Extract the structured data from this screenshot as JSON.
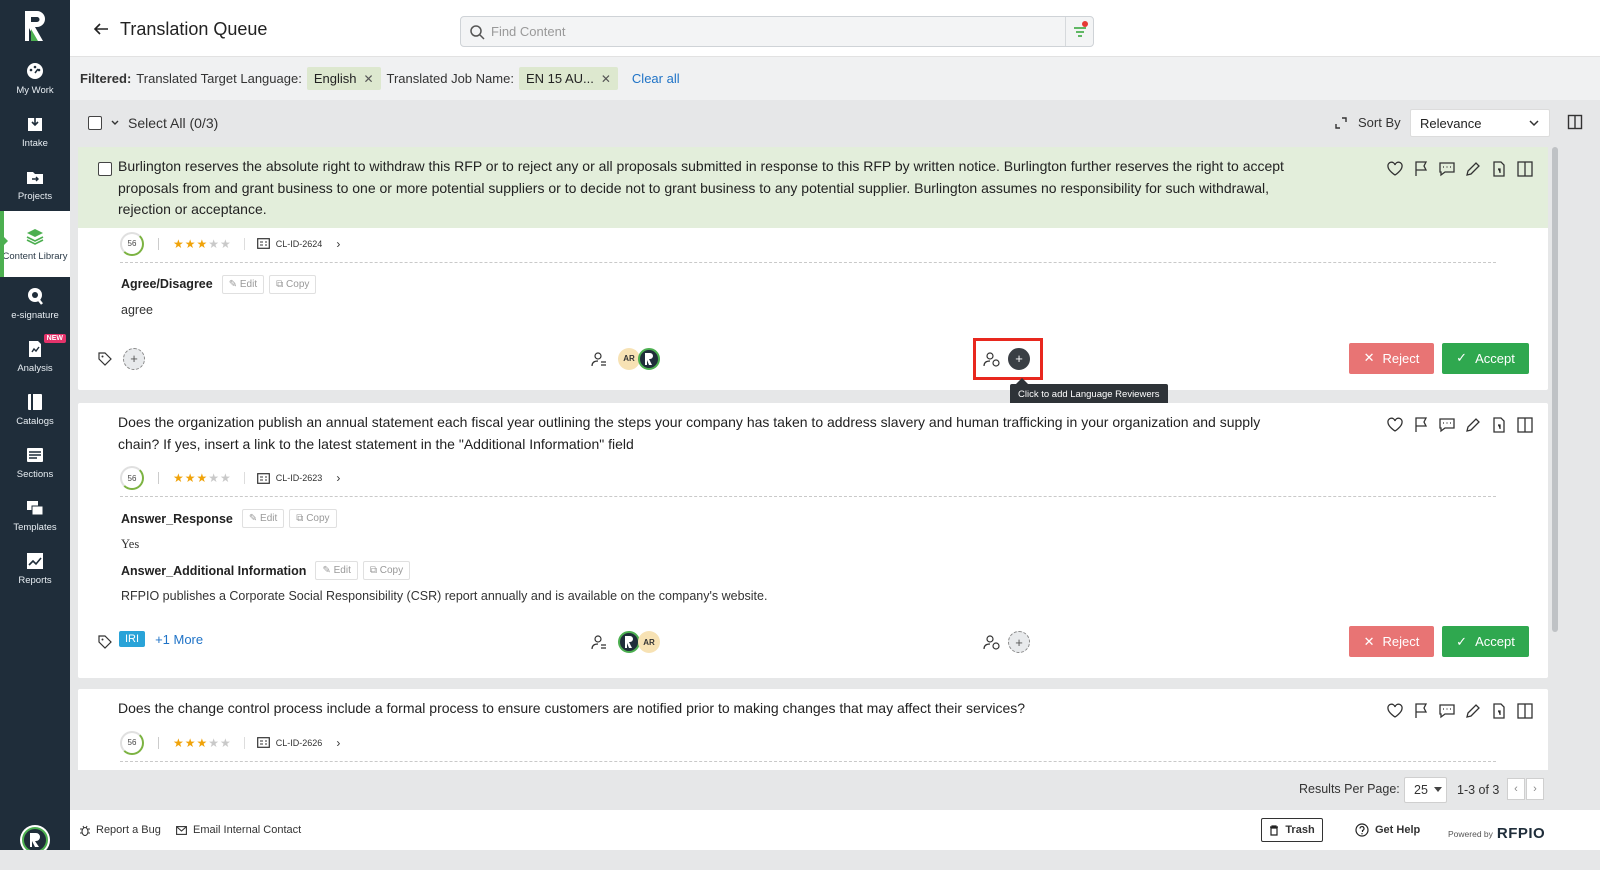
{
  "sidebar": {
    "items": [
      {
        "label": "My Work",
        "icon": "dashboard-icon"
      },
      {
        "label": "Intake",
        "icon": "intake-icon"
      },
      {
        "label": "Projects",
        "icon": "projects-icon"
      },
      {
        "label": "Content Library",
        "icon": "content-library-icon",
        "active": true
      },
      {
        "label": "e-signature",
        "icon": "esignature-icon"
      },
      {
        "label": "Analysis",
        "icon": "analysis-icon",
        "badge": "NEW"
      },
      {
        "label": "Catalogs",
        "icon": "catalogs-icon"
      },
      {
        "label": "Sections",
        "icon": "sections-icon"
      },
      {
        "label": "Templates",
        "icon": "templates-icon"
      },
      {
        "label": "Reports",
        "icon": "reports-icon"
      }
    ]
  },
  "header": {
    "title": "Translation Queue",
    "search_placeholder": "Find Content"
  },
  "filters": {
    "label": "Filtered:",
    "items": [
      {
        "name": "Translated Target Language:",
        "value": "English"
      },
      {
        "name": "Translated Job Name:",
        "value": "EN 15 AU..."
      }
    ],
    "clear": "Clear all"
  },
  "toolbar": {
    "select_all": "Select All (0/3)",
    "sort_label": "Sort By",
    "sort_value": "Relevance"
  },
  "cards": [
    {
      "question": "Burlington reserves the absolute right to withdraw this RFP or to reject any or all proposals submitted in response to this RFP by written notice. Burlington further reserves the right to accept proposals from and grant business to one or more potential suppliers or to decide not to grant business to any potential supplier. Burlington assumes no responsibility for such withdrawal, rejection or acceptance.",
      "score": "56",
      "rating": 3,
      "content_id": "CL-ID-2624",
      "fields": [
        {
          "name": "Agree/Disagree",
          "value": "agree"
        }
      ],
      "owner_avatar": "AR"
    },
    {
      "question": "Does the organization publish an annual statement each fiscal year outlining the steps your company has taken to address slavery and human trafficking in your organization and supply chain? If yes, insert a link to the latest statement in the \"Additional Information\" field",
      "score": "56",
      "rating": 3,
      "content_id": "CL-ID-2623",
      "fields": [
        {
          "name": "Answer_Response",
          "value": "Yes"
        },
        {
          "name": "Answer_Additional Information",
          "value": "RFPIO publishes a Corporate Social Responsibility (CSR) report annually and is available on the company's website."
        }
      ],
      "tag": "IRI",
      "more_tags": "+1 More",
      "owner_avatar": "AR"
    },
    {
      "question": "Does the change control process include a formal process to ensure customers are notified prior to making changes that may affect their services?",
      "score": "56",
      "rating": 3,
      "content_id": "CL-ID-2626"
    }
  ],
  "field_buttons": {
    "edit": "Edit",
    "copy": "Copy"
  },
  "buttons": {
    "reject": "Reject",
    "accept": "Accept"
  },
  "tooltip": "Click to add Language Reviewers",
  "pagination": {
    "label": "Results Per Page:",
    "per_page": "25",
    "range": "1-3 of 3"
  },
  "footer": {
    "report_bug": "Report a Bug",
    "email_contact": "Email Internal Contact",
    "trash": "Trash",
    "help": "Get Help",
    "powered_by": "Powered by",
    "brand": "RFPIO"
  },
  "colors": {
    "sidebar": "#1f2d3a",
    "accent": "#4caf50",
    "reject": "#e87474",
    "accept": "#2fa84f",
    "highlight": "#e3eedb"
  }
}
